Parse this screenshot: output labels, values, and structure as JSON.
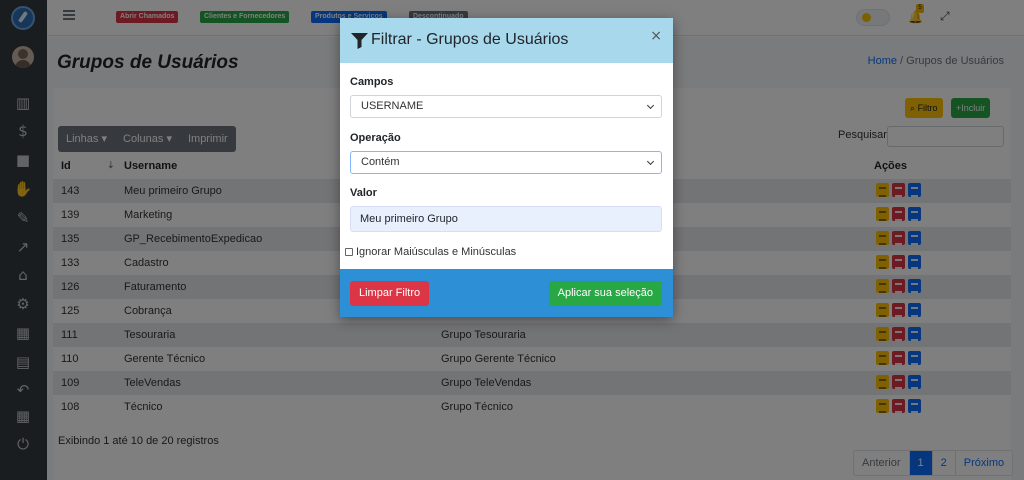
{
  "nav_tags": [
    {
      "label": "Abrir Chamados",
      "color": "#dc3545"
    },
    {
      "label": "Clientes e Fornecedores",
      "color": "#28a745"
    },
    {
      "label": "Produtos e Serviços",
      "color": "#0d6efd"
    },
    {
      "label": "Descontinuado",
      "color": "#6c757d"
    }
  ],
  "header": {
    "bell_count": "5"
  },
  "page": {
    "title": "Grupos de Usuários",
    "breadcrumb_home": "Home",
    "breadcrumb_sep": "/",
    "breadcrumb_current": "Grupos de Usuários"
  },
  "toolbar": {
    "filter_label": "Filtro",
    "add_label": "Incluir",
    "rows_label": "Linhas",
    "cols_label": "Colunas",
    "print_label": "Imprimir",
    "search_label": "Pesquisar"
  },
  "table": {
    "headers": {
      "id": "Id",
      "username": "Username",
      "actions": "Ações"
    },
    "rows": [
      {
        "id": "143",
        "username": "Meu primeiro Grupo",
        "desc": ""
      },
      {
        "id": "139",
        "username": "Marketing",
        "desc": ""
      },
      {
        "id": "135",
        "username": "GP_RecebimentoExpedicao",
        "desc": ""
      },
      {
        "id": "133",
        "username": "Cadastro",
        "desc": ""
      },
      {
        "id": "126",
        "username": "Faturamento",
        "desc": ""
      },
      {
        "id": "125",
        "username": "Cobrança",
        "desc": ""
      },
      {
        "id": "111",
        "username": "Tesouraria",
        "desc": "Grupo Tesouraria"
      },
      {
        "id": "110",
        "username": "Gerente Técnico",
        "desc": "Grupo Gerente Técnico"
      },
      {
        "id": "109",
        "username": "TeleVendas",
        "desc": "Grupo TeleVendas"
      },
      {
        "id": "108",
        "username": "Técnico",
        "desc": "Grupo Técnico"
      }
    ]
  },
  "footer": {
    "info": "Exibindo 1 até 10 de 20 registros",
    "prev": "Anterior",
    "page1": "1",
    "page2": "2",
    "next": "Próximo"
  },
  "modal": {
    "title": "Filtrar - Grupos de Usuários",
    "close": "×",
    "campos_label": "Campos",
    "campos_value": "USERNAME",
    "operacao_label": "Operação",
    "operacao_value": "Contém",
    "valor_label": "Valor",
    "valor_value": "Meu primeiro Grupo",
    "ignore_case_label": "Ignorar Maiúsculas e Minúsculas",
    "clear_label": "Limpar Filtro",
    "apply_label": "Aplicar sua seleção"
  },
  "colors": {
    "header": "#a8d8ec",
    "footer": "#2d8fd5",
    "danger": "#dc3545",
    "success": "#28a745",
    "sidebar": "#343a40"
  }
}
